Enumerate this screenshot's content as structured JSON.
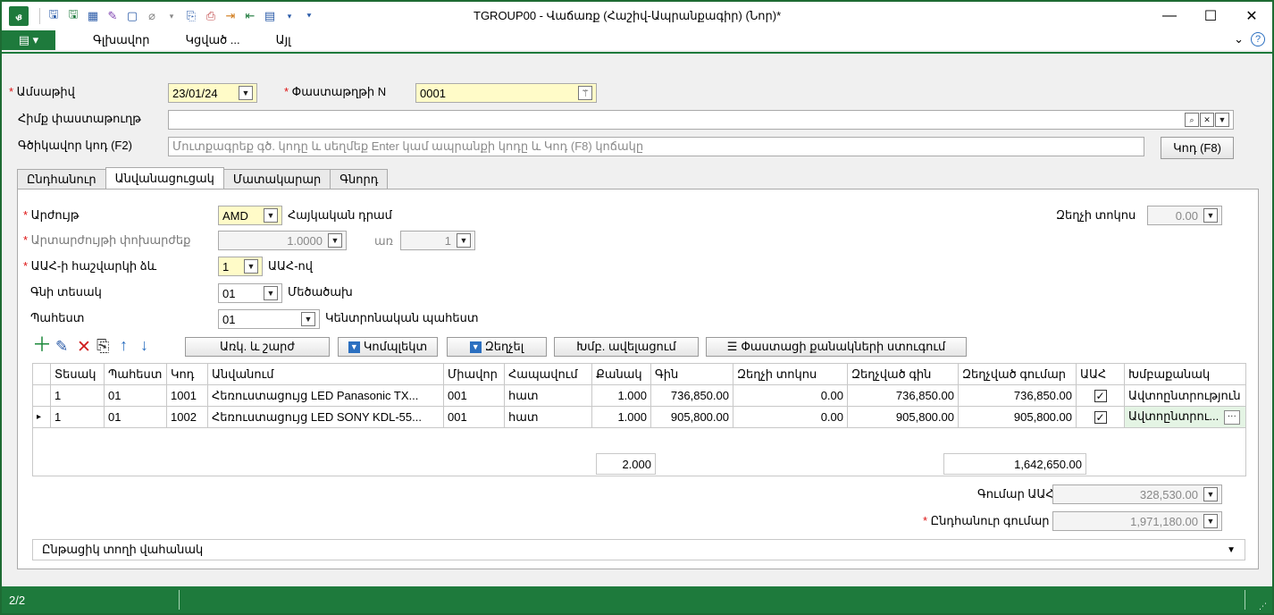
{
  "window": {
    "title": "TGROUP00 - Վաճառք (Հաշիվ-Ապրանքագիր) (Նոր)*",
    "app_icon": "app-logo-icon",
    "minimize": "—",
    "maximize": "☐",
    "close": "✕"
  },
  "menu": {
    "file_label": "▤ ▾",
    "items": [
      "Գլխավոր",
      "Կցված ...",
      "Այլ"
    ],
    "collapse": "⌄",
    "help": "?"
  },
  "header": {
    "date_label": "Ամսաթիվ",
    "date_value": "23/01/24",
    "doc_num_label": "Փաստաթղթի N",
    "doc_num_value": "0001",
    "base_doc_label": "Հիմք փաստաթուղթ",
    "base_doc_value": "",
    "barcode_label": "Գծիկավոր կոդ (F2)",
    "barcode_placeholder": "Մուտքագրեք գծ. կոդը և սեղմեք Enter կամ ապրանքի կոդը և Կոդ (F8) կոճակը",
    "code_button": "Կոդ (F8)"
  },
  "tabs": [
    "Ընդհանուր",
    "Անվանացուցակ",
    "Մատակարար",
    "Գնորդ"
  ],
  "active_tab": 1,
  "form": {
    "currency_label": "Արժույթ",
    "currency_value": "AMD",
    "currency_name": "Հայկական դրամ",
    "rate_label": "Արտարժույթի փոխարժեք",
    "rate_value": "1.0000",
    "rate_for": "առ",
    "rate_for_value": "1",
    "vat_mode_label": "ԱԱՀ-ի հաշվարկի ձև",
    "vat_mode_value": "1",
    "vat_mode_name": "ԱԱՀ-ով",
    "price_type_label": "Գնի տեսակ",
    "price_type_value": "01",
    "price_type_name": "Մեծածախ",
    "warehouse_label": "Պահեստ",
    "warehouse_value": "01",
    "warehouse_name": "Կենտրոնական պահեստ",
    "discount_label": "Զեղչի տոկոս",
    "discount_value": "0.00"
  },
  "toolbar": {
    "add": "＋",
    "edit": "✎",
    "delete": "✕",
    "copy": "⎘",
    "up": "↑",
    "down": "↓",
    "btn_receive": "Առկ. և շարժ",
    "btn_complete": "Կոմպլեկտ",
    "btn_discount": "Զեղչել",
    "btn_group_add": "Խմբ. ավելացում",
    "btn_qty": "Փաստացի քանակների ստուգում"
  },
  "grid": {
    "columns": [
      "Տեսակ",
      "Պահեստ",
      "Կոդ",
      "Անվանում",
      "Միավոր",
      "Հապավում",
      "Քանակ",
      "Գին",
      "Զեղչի տոկոս",
      "Զեղչված գին",
      "Զեղչված գումար",
      "ԱԱՀ",
      "Խմբաքանակ"
    ],
    "rows": [
      {
        "marker": "",
        "type": "1",
        "warehouse": "01",
        "code": "1001",
        "name": "Հեռուստացույց LED Panasonic TX...",
        "unit": "001",
        "abbr": "հատ",
        "qty": "1.000",
        "price": "736,850.00",
        "disc_pct": "0.00",
        "disc_price": "736,850.00",
        "disc_sum": "736,850.00",
        "vat": true,
        "batch": "Ավտոընտրություն"
      },
      {
        "marker": "▸",
        "type": "1",
        "warehouse": "01",
        "code": "1002",
        "name": "Հեռուստացույց LED SONY KDL-55...",
        "unit": "001",
        "abbr": "հատ",
        "qty": "1.000",
        "price": "905,800.00",
        "disc_pct": "0.00",
        "disc_price": "905,800.00",
        "disc_sum": "905,800.00",
        "vat": true,
        "batch": "Ավտոընտրու..."
      }
    ],
    "total_qty": "2.000",
    "total_sum": "1,642,650.00"
  },
  "totals": {
    "vat_label": "Գումար ԱԱՀ",
    "vat_value": "328,530.00",
    "total_label": "Ընդհանուր գումար",
    "total_value": "1,971,180.00"
  },
  "bottom": {
    "row_view_label": "Ընթացիկ տողի վահանակ",
    "status_count": "2/2"
  },
  "colors": {
    "accent": "#1e7a3c",
    "required": "#d11111",
    "highlight": "#fffbc8"
  }
}
